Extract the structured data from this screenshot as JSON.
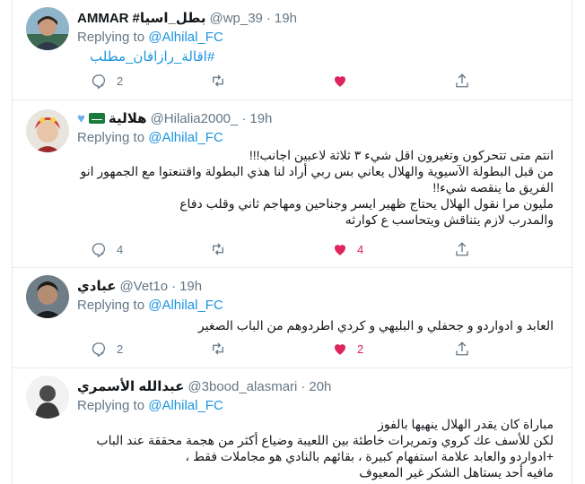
{
  "tweets": [
    {
      "name": "AMMAR",
      "name_suffix": "#بطل_اسيا",
      "handle": "@wp_39",
      "time": "19h",
      "reply_prefix": "Replying to",
      "reply_to": "@Alhilal_FC",
      "hashtag": "#اقالة_رازافان_مطلب",
      "counts": {
        "reply": "2",
        "retweet": "",
        "like": ""
      },
      "liked": true
    },
    {
      "name": "هلالية",
      "handle": "@Hilalia2000_",
      "time": "19h",
      "reply_prefix": "Replying to",
      "reply_to": "@Alhilal_FC",
      "text": "انتم متى تتحركون وتغيرون اقل شيء ٣ ثلاثة لاعبين اجانب!!!\nمن قبل البطولة الآسيوية والهلال يعاني بس ربي أراد لنا هذي البطولة واقتنعتوا مع الجمهور انو الفريق ما ينقصه شيء!!\nمليون مرا نقول الهلال يحتاج ظهير ايسر وجناحين ومهاجم ثاني وقلب دفاع\nوالمدرب لازم يتناقش ويتحاسب ع كوارثه",
      "counts": {
        "reply": "4",
        "retweet": "",
        "like": "4"
      },
      "liked": true
    },
    {
      "name": "عبادي",
      "handle": "@Vet1o",
      "time": "19h",
      "reply_prefix": "Replying to",
      "reply_to": "@Alhilal_FC",
      "text": "العابد و ادواردو و جحفلي و البليهي و كردي اطردوهم من الباب الصغير",
      "counts": {
        "reply": "2",
        "retweet": "",
        "like": "2"
      },
      "liked": true
    },
    {
      "name": "عبدالله الأسمري",
      "handle": "@3bood_alasmari",
      "time": "20h",
      "reply_prefix": "Replying to",
      "reply_to": "@Alhilal_FC",
      "text": "مباراة كان يقدر الهلال ينهيها بالفوز\nلكن للأسف عك كروي وتمريرات خاطئة بين اللعيبة وضياع أكثر من هجمة محققة عند الباب\n+ادواردو والعابد علامة استفهام كبيرة ، بقائهم بالنادي هو مجاملات فقط ،\nمافيه أحد يستاهل الشكر غير المعيوف"
    }
  ],
  "colors": {
    "link": "#1b95e0",
    "secondary_text": "#657786",
    "like": "#e0245e",
    "border": "#e6ecf0"
  },
  "icons": [
    "reply-icon",
    "retweet-icon",
    "like-icon",
    "share-icon",
    "saudi-flag-icon",
    "blue-heart-icon"
  ]
}
